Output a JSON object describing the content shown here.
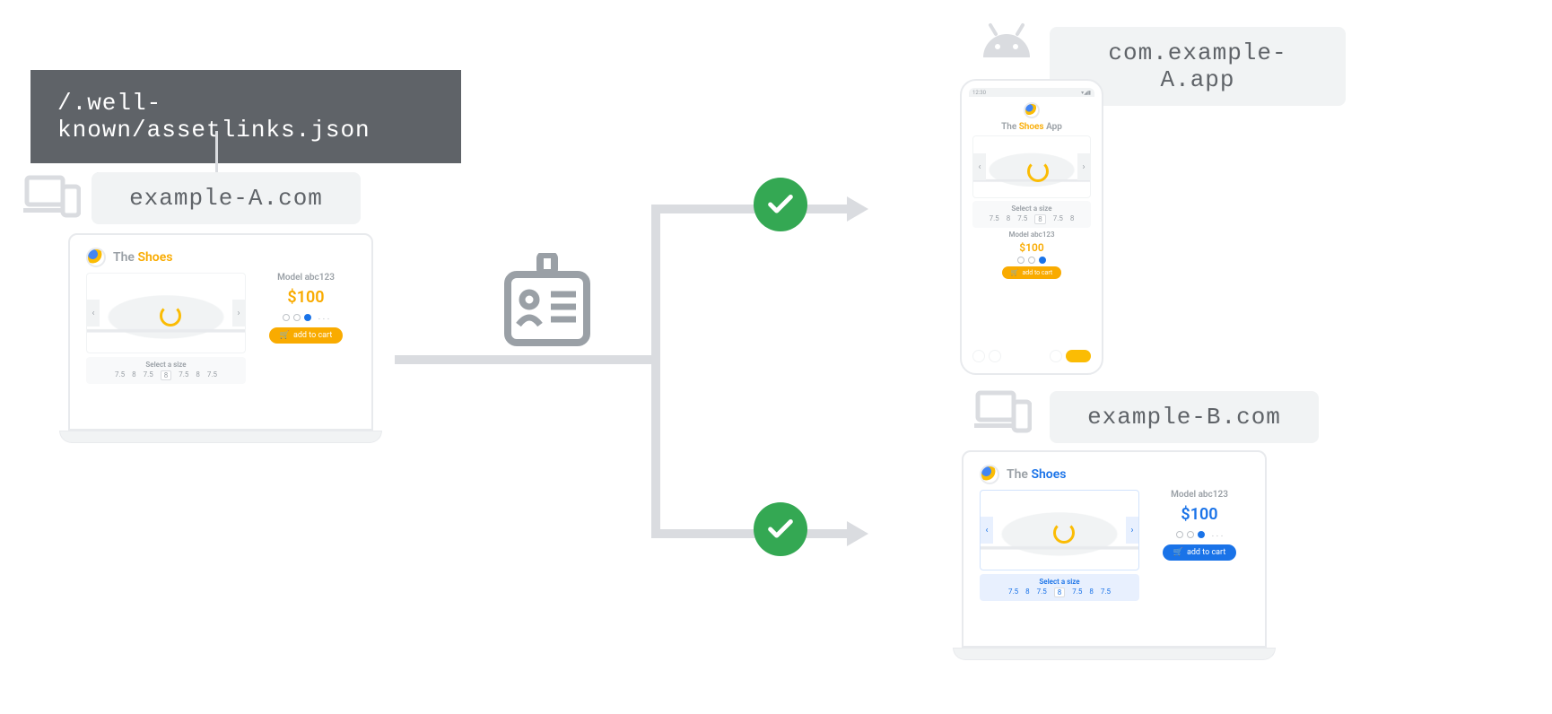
{
  "assetlinks_path": "/.well-known/assetlinks.json",
  "site_a": "example-A.com",
  "site_b": "example-B.com",
  "app_id": "com.example-A.app",
  "store": {
    "brand_prefix": "The",
    "brand_accent": "Shoes",
    "app_suffix": "App",
    "model": "Model abc123",
    "price": "$100",
    "add_to_cart": "add to cart",
    "select_size": "Select a size",
    "sizes": [
      "7.5",
      "8",
      "7.5",
      "8",
      "7.5",
      "8",
      "7.5"
    ]
  },
  "phone_time": "12:30"
}
